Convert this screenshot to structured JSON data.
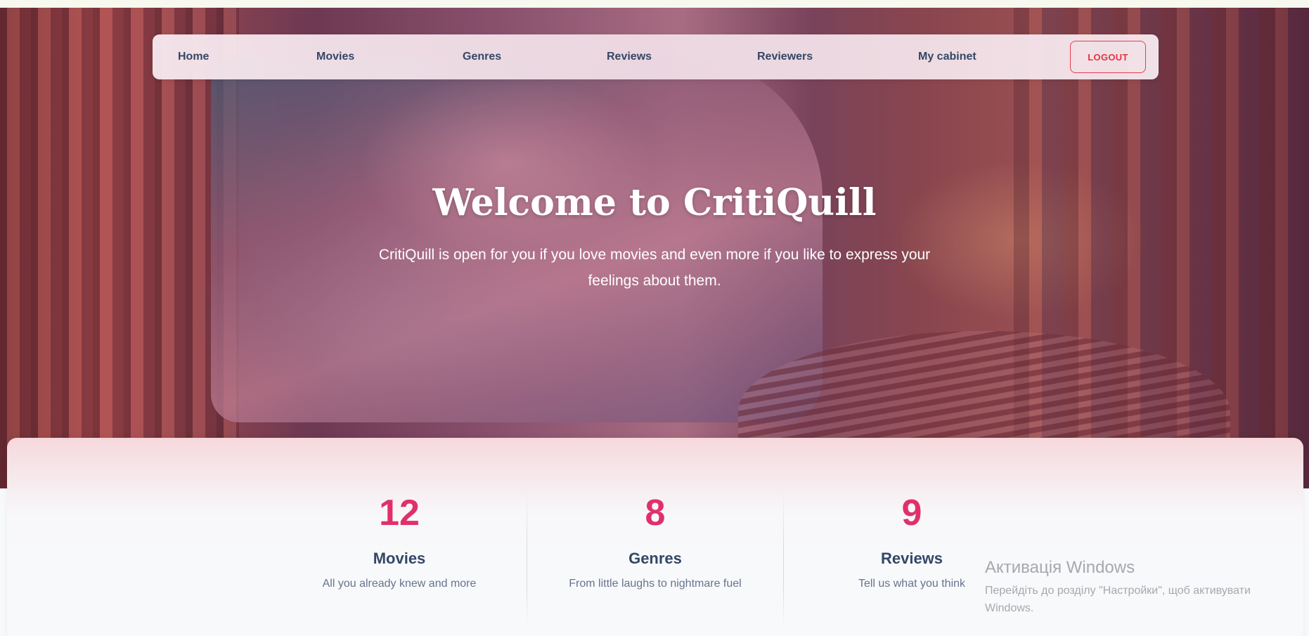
{
  "nav": {
    "home": "Home",
    "movies": "Movies",
    "genres": "Genres",
    "reviews": "Reviews",
    "reviewers": "Reviewers",
    "cabinet": "My cabinet",
    "logout": "LOGOUT"
  },
  "hero": {
    "title": "Welcome to CritiQuill",
    "subtitle": "CritiQuill is open for you if you love movies and even more if you like to express your feelings about them."
  },
  "stats": [
    {
      "number": "12",
      "label": "Movies",
      "description": "All you already knew and more"
    },
    {
      "number": "8",
      "label": "Genres",
      "description": "From little laughs to nightmare fuel"
    },
    {
      "number": "9",
      "label": "Reviews",
      "description": "Tell us what you think"
    }
  ],
  "watermark": {
    "title": "Активація Windows",
    "text": "Перейдіть до розділу \"Настройки\", щоб активувати Windows."
  },
  "colors": {
    "accent": "#e0306a",
    "logout": "#e5323f",
    "text_dark": "#344767"
  }
}
